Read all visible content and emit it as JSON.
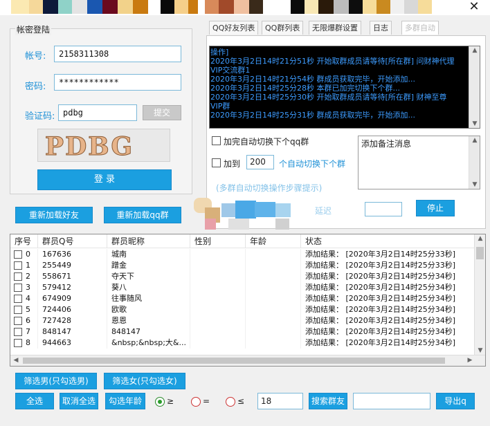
{
  "window": {
    "close_glyph": "✕"
  },
  "login": {
    "group_title": "帐密登陆",
    "account_label": "帐号:",
    "account_value": "2158311308",
    "password_label": "密码:",
    "password_value": "************",
    "captcha_label": "验证码:",
    "captcha_value": "pdbg",
    "submit_captcha": "提交",
    "captcha_image_text": "PDBG",
    "login_button": "登 录",
    "reload_friends": "重新加载好友",
    "reload_groups": "重新加载qq群"
  },
  "tabs": [
    {
      "label": "QQ好友列表"
    },
    {
      "label": "QQ群列表"
    },
    {
      "label": "无限爆群设置"
    },
    {
      "label": "日志"
    },
    {
      "label": "多群自动"
    }
  ],
  "log": {
    "lines": [
      "操作]",
      "2020年3月2日14时21分51秒 开始取群成员请等待[所在群] 问财神代理",
      "VIP交流群1",
      "2020年3月2日14时21分54秒 群成员获取完毕，开始添加...",
      "2020年3月2日14时25分28秒 本群已加完切换下个群...",
      "2020年3月2日14时25分30秒 开始取群成员请等待[所在群] 财神至尊",
      "VIP群",
      "2020年3月2日14时25分31秒 群成员获取完毕，开始添加..."
    ]
  },
  "options": {
    "auto_switch_label": "加完自动切换下个qq群",
    "add_to_label": "加到",
    "add_to_value": "200",
    "add_to_suffix": "个自动切换下个群",
    "multi_group_hint": "(多群自动切换操作步骤提示)",
    "remark_placeholder": "添加备注消息",
    "delay_label": "延迟",
    "stop_button": "停止"
  },
  "table": {
    "columns": [
      "序号",
      "群员Q号",
      "群员昵称",
      "性别",
      "年龄",
      "状态"
    ],
    "rows": [
      {
        "idx": "0",
        "qq": "167636",
        "nick": "城南",
        "gender": "",
        "age": "",
        "status": "添加结果：  [2020年3月2日14时25分33秒]"
      },
      {
        "idx": "1",
        "qq": "255449",
        "nick": "蹭金",
        "gender": "",
        "age": "",
        "status": "添加结果：  [2020年3月2日14时25分33秒]"
      },
      {
        "idx": "2",
        "qq": "558671",
        "nick": "夺天下",
        "gender": "",
        "age": "",
        "status": "添加结果：  [2020年3月2日14时25分34秒]"
      },
      {
        "idx": "3",
        "qq": "579412",
        "nick": "葵八",
        "gender": "",
        "age": "",
        "status": "添加结果：  [2020年3月2日14时25分34秒]"
      },
      {
        "idx": "4",
        "qq": "674909",
        "nick": "往事随风",
        "gender": "",
        "age": "",
        "status": "添加结果：  [2020年3月2日14时25分34秒]"
      },
      {
        "idx": "5",
        "qq": "724406",
        "nick": "欧歌",
        "gender": "",
        "age": "",
        "status": "添加结果：  [2020年3月2日14时25分34秒]"
      },
      {
        "idx": "6",
        "qq": "727428",
        "nick": "恩恩",
        "gender": "",
        "age": "",
        "status": "添加结果：  [2020年3月2日14时25分34秒]"
      },
      {
        "idx": "7",
        "qq": "848147",
        "nick": "848147",
        "gender": "",
        "age": "",
        "status": "添加结果：  [2020年3月2日14时25分34秒]"
      },
      {
        "idx": "8",
        "qq": "944663",
        "nick": "&nbsp;&nbsp;大&...",
        "gender": "",
        "age": "",
        "status": "添加结果：  [2020年3月2日14时25分34秒]"
      }
    ]
  },
  "bottom": {
    "filter_male": "筛选男(只勾选男)",
    "filter_female": "筛选女(只勾选女)",
    "select_all": "全选",
    "deselect_all": "取消全选",
    "check_age": "勾选年龄",
    "op_gte": "≥",
    "op_eq": "=",
    "op_lte": "≤",
    "age_value": "18",
    "search_button": "搜索群友",
    "search_value": "",
    "export_button": "导出q"
  },
  "colors": {
    "accent": "#1b9fe0",
    "log_bg": "#000000",
    "log_text": "#3d9cff",
    "label_blue": "#1e90d6"
  }
}
